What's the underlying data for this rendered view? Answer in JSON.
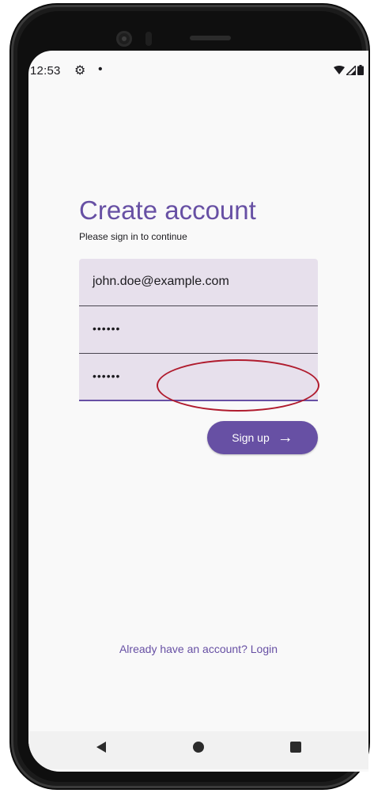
{
  "status_bar": {
    "time": "12:53",
    "settings_icon": "gear-icon",
    "notification_dot": "•"
  },
  "screen": {
    "title": "Create account",
    "subtitle": "Please sign in to continue",
    "email_value": "john.doe@example.com",
    "password_value": "••••••",
    "confirm_password_value": "••••••",
    "signup_label": "Sign up",
    "signup_icon": "arrow-right-icon",
    "login_link": "Already have an account? Login"
  },
  "colors": {
    "primary": "#6750a4",
    "field_background": "#e7e0ec",
    "screen_background": "#f9f9f9",
    "highlight": "#b01c2e"
  },
  "nav_bar": {
    "back_icon": "back-triangle-icon",
    "home_icon": "home-circle-icon",
    "recents_icon": "recents-square-icon"
  }
}
